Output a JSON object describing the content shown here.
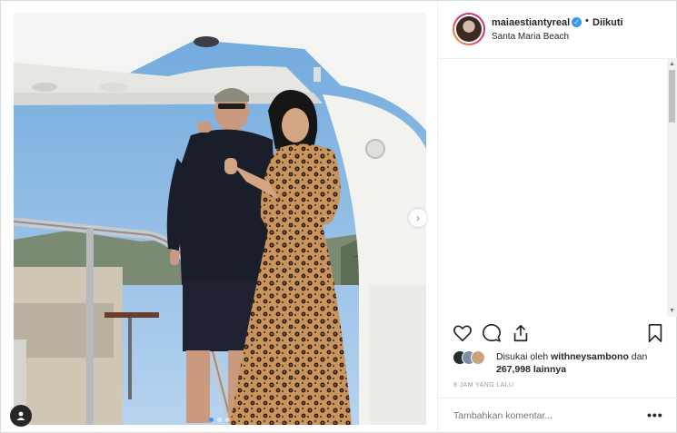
{
  "post": {
    "username": "maiaestiantyreal",
    "verified_icon": "verified-badge-icon",
    "separator": "•",
    "follow_status": "Diikuti",
    "location": "Santa Maria Beach",
    "photo_subject": "photo-yacht-couple",
    "carousel": {
      "total_slides": 3,
      "active_slide": 1,
      "next_icon": "chevron-right-icon"
    },
    "user_tag_icon": "user-tag-icon"
  },
  "actions": {
    "like_icon": "heart-icon",
    "comment_icon": "comment-icon",
    "share_icon": "share-icon",
    "save_icon": "bookmark-icon"
  },
  "likes": {
    "prefix": "Disukai oleh ",
    "first_liker": "withneysambono",
    "joiner": " dan",
    "others": "267,998 lainnya"
  },
  "timestamp": "8 JAM YANG LALU",
  "comment": {
    "placeholder": "Tambahkan komentar...",
    "more_label": "•••"
  },
  "colors": {
    "accent": "#3897f0",
    "text": "#262626",
    "muted": "#999999",
    "border": "#efefef"
  }
}
